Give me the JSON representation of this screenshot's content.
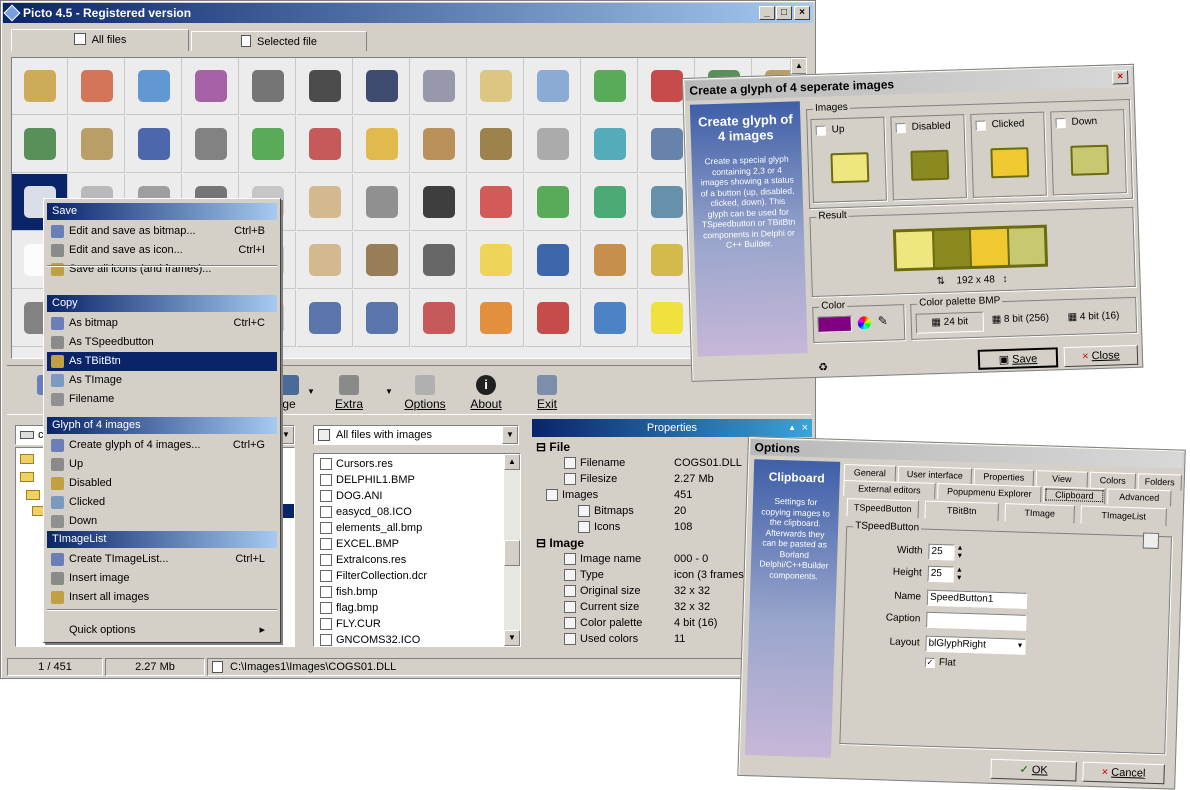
{
  "main": {
    "title": "Picto 4.5 - Registered version",
    "tabs": [
      "All files",
      "Selected file"
    ],
    "toolbar": [
      "Extra",
      "Options",
      "About",
      "Exit"
    ],
    "toolbar_partial": [
      "S",
      "ge"
    ],
    "filter": "All files with images",
    "files": [
      "Cursors.res",
      "DELPHIL1.BMP",
      "DOG.ANI",
      "easycd_08.ICO",
      "elements_all.bmp",
      "EXCEL.BMP",
      "ExtraIcons.res",
      "FilterCollection.dcr",
      "fish.bmp",
      "flag.bmp",
      "FLY.CUR",
      "GNCOMS32.ICO"
    ],
    "drive_partial": "c",
    "properties": {
      "title": "Properties",
      "file_section": "File",
      "image_section": "Image",
      "rows": [
        {
          "label": "Filename",
          "value": "COGS01.DLL"
        },
        {
          "label": "Filesize",
          "value": "2.27 Mb"
        },
        {
          "label": "Images",
          "value": "451"
        },
        {
          "label": "Bitmaps",
          "value": "20"
        },
        {
          "label": "Icons",
          "value": "108"
        },
        {
          "label": "Image name",
          "value": "000 - 0"
        },
        {
          "label": "Type",
          "value": "icon (3 frames"
        },
        {
          "label": "Original size",
          "value": "32 x 32"
        },
        {
          "label": "Current size",
          "value": "32 x 32"
        },
        {
          "label": "Color palette",
          "value": "4 bit (16)"
        },
        {
          "label": "Used colors",
          "value": "11"
        }
      ]
    },
    "status": {
      "count": "1 / 451",
      "size": "2.27 Mb",
      "path": "C:\\Images1\\Images\\COGS01.DLL"
    }
  },
  "menu": {
    "sections": [
      {
        "header": "Save",
        "items": [
          {
            "label": "Edit and save as bitmap...",
            "shortcut": "Ctrl+B"
          },
          {
            "label": "Edit and save as icon...",
            "shortcut": "Ctrl+I"
          },
          {
            "label": "Save all icons (and frames)...",
            "shortcut": ""
          }
        ]
      },
      {
        "header": "Copy",
        "items": [
          {
            "label": "As bitmap",
            "shortcut": "Ctrl+C"
          },
          {
            "label": "As TSpeedbutton",
            "shortcut": ""
          },
          {
            "label": "As TBitBtn",
            "shortcut": ""
          },
          {
            "label": "As TImage",
            "shortcut": ""
          },
          {
            "label": "Filename",
            "shortcut": ""
          }
        ]
      },
      {
        "header": "Glyph of 4 images",
        "items": [
          {
            "label": "Create glyph of 4 images...",
            "shortcut": "Ctrl+G"
          },
          {
            "label": "Up",
            "shortcut": ""
          },
          {
            "label": "Disabled",
            "shortcut": ""
          },
          {
            "label": "Clicked",
            "shortcut": ""
          },
          {
            "label": "Down",
            "shortcut": ""
          }
        ]
      },
      {
        "header": "TImageList",
        "items": [
          {
            "label": "Create TImageList...",
            "shortcut": "Ctrl+L"
          },
          {
            "label": "Insert image",
            "shortcut": ""
          },
          {
            "label": "Insert all images",
            "shortcut": ""
          }
        ]
      }
    ],
    "quick": "Quick options"
  },
  "glyph": {
    "title": "Create a glyph of 4 seperate images",
    "side_title": "Create glyph of 4 images",
    "side_text": "Create a special glyph containing 2,3 or 4 images showing a status of a button (up, disabled, clicked, down). This glyph can be used for TSpeedbutton or TBitBtn components in Delphi or C++ Builder.",
    "images_label": "Images",
    "states": [
      "Up",
      "Disabled",
      "Clicked",
      "Down"
    ],
    "result_label": "Result",
    "size": "192 x 48",
    "color_label": "Color",
    "palette_label": "Color palette BMP",
    "palettes": [
      "24 bit",
      "8 bit (256)",
      "4 bit (16)"
    ],
    "save": "Save",
    "close": "Close",
    "accent": "#800080"
  },
  "options": {
    "title": "Options",
    "side_title": "Clipboard",
    "side_text": "Settings for copying images to the clipboard. Afterwards they can be pasted as Borland Delphi/C++Builder components.",
    "tabs_row1": [
      "General",
      "User interface",
      "Properties",
      "View",
      "Colors",
      "Folders"
    ],
    "tabs_row2": [
      "External editors",
      "Popupmenu Explorer",
      "Clipboard",
      "Advanced"
    ],
    "subtabs": [
      "TSpeedButton",
      "TBitBtn",
      "TImage",
      "TImageList"
    ],
    "group": "TSpeedButton",
    "width_label": "Width",
    "width": "25",
    "height_label": "Height",
    "height": "25",
    "name_label": "Name",
    "name": "SpeedButton1",
    "caption_label": "Caption",
    "caption": "",
    "layout_label": "Layout",
    "layout": "blGlyphRight",
    "flat": "Flat",
    "ok": "OK",
    "cancel": "Cancel"
  }
}
